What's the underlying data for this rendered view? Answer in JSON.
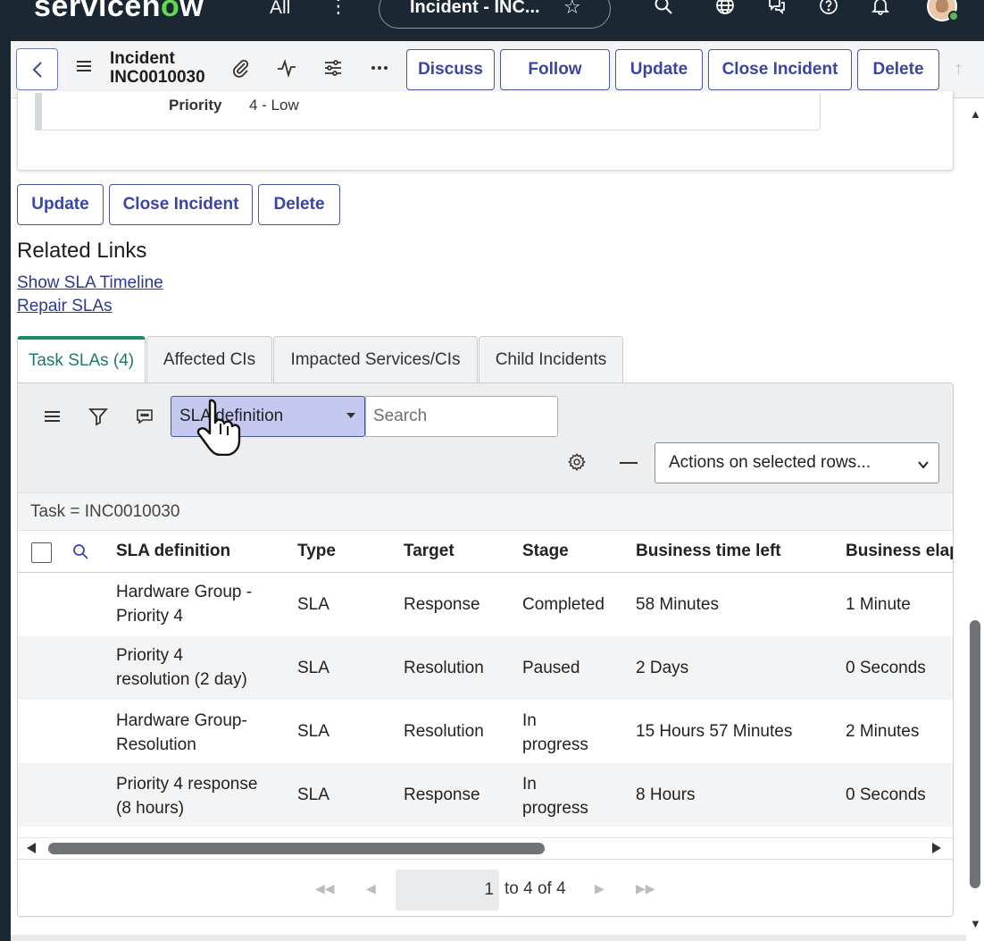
{
  "app": {
    "brand_prefix": "servicen",
    "brand_o": "o",
    "brand_suffix": "w",
    "all_menu": "All",
    "kebab": "⋮",
    "context_pill": "Incident - INC...",
    "star": "☆"
  },
  "form_header": {
    "record_type": "Incident",
    "record_number": "INC0010030",
    "buttons": {
      "discuss": "Discuss",
      "follow": "Follow",
      "update": "Update",
      "close_incident": "Close Incident",
      "delete": "Delete"
    }
  },
  "form": {
    "priority_label": "Priority",
    "priority_value": "4 - Low"
  },
  "bottom_buttons": {
    "update": "Update",
    "close_incident": "Close Incident",
    "delete": "Delete"
  },
  "related_links": {
    "title": "Related Links",
    "links": [
      "Show SLA Timeline",
      "Repair SLAs"
    ]
  },
  "tabs": [
    {
      "label": "Task SLAs (4)",
      "active": true
    },
    {
      "label": "Affected CIs",
      "active": false
    },
    {
      "label": "Impacted Services/CIs",
      "active": false
    },
    {
      "label": "Child Incidents",
      "active": false
    }
  ],
  "list": {
    "search_field": "SLA definition",
    "search_placeholder": "Search",
    "actions_select": "Actions on selected rows...",
    "filter_breadcrumb": "Task = INC0010030",
    "columns": [
      "SLA definition",
      "Type",
      "Target",
      "Stage",
      "Business time left",
      "Business elap"
    ],
    "rows": [
      {
        "sla_line1": "Hardware Group -",
        "sla_line2": "Priority 4",
        "type": "SLA",
        "target": "Response",
        "stage_line1": "Completed",
        "stage_line2": "",
        "time_left": "58 Minutes",
        "elapsed": "1 Minute"
      },
      {
        "sla_line1": "Priority 4",
        "sla_line2": "resolution (2 day)",
        "type": "SLA",
        "target": "Resolution",
        "stage_line1": "Paused",
        "stage_line2": "",
        "time_left": "2 Days",
        "elapsed": "0 Seconds"
      },
      {
        "sla_line1": "Hardware Group-",
        "sla_line2": "Resolution",
        "type": "SLA",
        "target": "Resolution",
        "stage_line1": "In",
        "stage_line2": "progress",
        "time_left": "15 Hours 57 Minutes",
        "elapsed": "2 Minutes"
      },
      {
        "sla_line1": "Priority 4 response",
        "sla_line2": "(8 hours)",
        "type": "SLA",
        "target": "Response",
        "stage_line1": "In",
        "stage_line2": "progress",
        "time_left": "8 Hours",
        "elapsed": "0 Seconds"
      }
    ],
    "pager": {
      "current": "1",
      "range_text": "to 4 of 4"
    }
  },
  "colors": {
    "header_bg": "#1b2733",
    "button_text": "#3a45a3",
    "active_tab": "#1b8a6b",
    "link": "#2a3a8f"
  }
}
